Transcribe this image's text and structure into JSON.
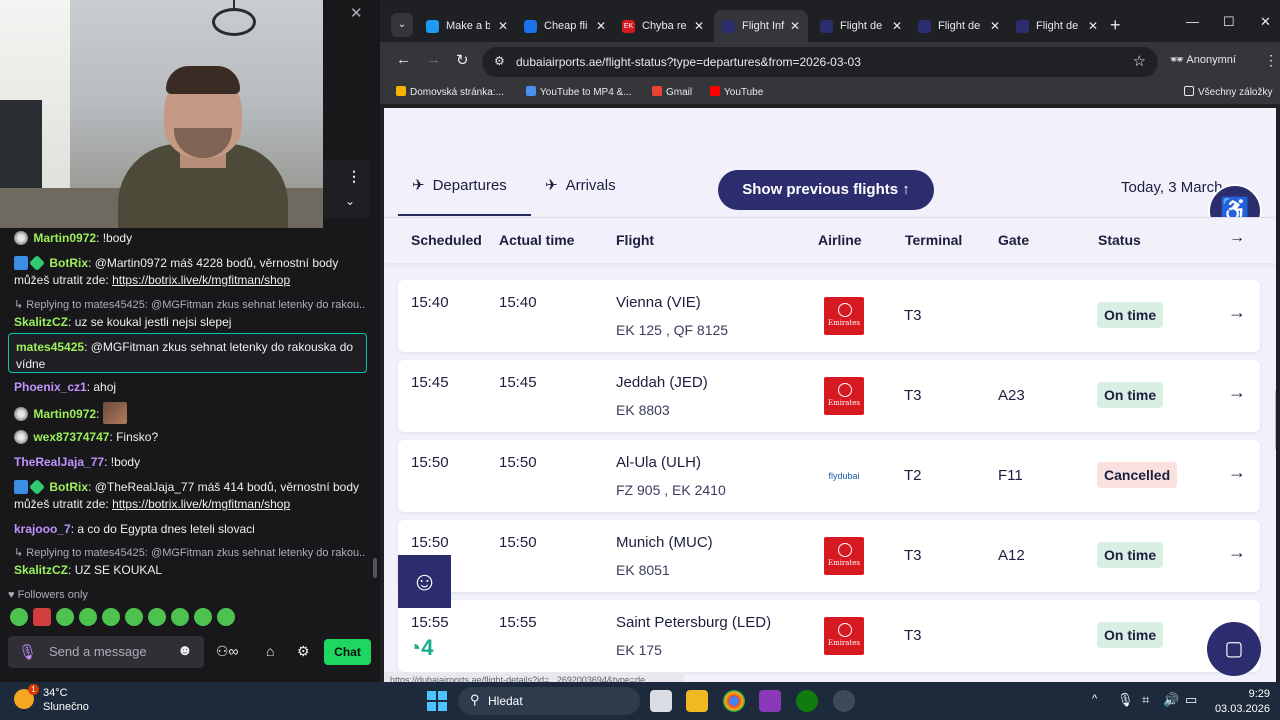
{
  "stream": {
    "close_glyph": "✕",
    "chat_messages": [
      {
        "user": "Martin0972",
        "user_color": "#9cf05a",
        "text": "!body",
        "badges": [
          "verified"
        ]
      },
      {
        "user": "BotRix",
        "user_color": "#9cf05a",
        "text": "@Martin0972 máš 4228 bodů, věrnostní body",
        "text2": "můžeš utratit zde:",
        "link": "https://botrix.live/k/mgfitman/shop",
        "badges": [
          "bot",
          "sub"
        ]
      },
      {
        "reply_to": "Replying to mates45425: @MGFitman zkus sehnat letenky do rakou...",
        "user": "SkalitzCZ",
        "user_color": "#9cf05a",
        "text": "uz se koukal jestli nejsi slepej"
      },
      {
        "user": "mates45425",
        "user_color": "#9cf05a",
        "text": "@MGFitman zkus sehnat letenky do rakouska do",
        "text2": "vídne",
        "highlighted": true
      },
      {
        "user": "Phoenix_cz1",
        "user_color": "#bf94ff",
        "text": "ahoj"
      },
      {
        "user": "Martin0972",
        "user_color": "#9cf05a",
        "text": "",
        "badges": [
          "verified"
        ],
        "emote": true
      },
      {
        "user": "wex87374747",
        "user_color": "#9cf05a",
        "text": "Finsko?",
        "badges": [
          "verified"
        ]
      },
      {
        "user": "TheRealJaja_77",
        "user_color": "#bf94ff",
        "text": "!body"
      },
      {
        "user": "BotRix",
        "user_color": "#9cf05a",
        "text": "@TheRealJaja_77 máš 414 bodů, věrnostní body",
        "text2": "můžeš utratit zde:",
        "link": "https://botrix.live/k/mgfitman/shop",
        "badges": [
          "bot",
          "sub"
        ]
      },
      {
        "user": "krajooo_7",
        "user_color": "#bf94ff",
        "text": "a co do Egypta dnes leteli slovaci"
      },
      {
        "reply_to": "Replying to mates45425: @MGFitman zkus sehnat letenky do rakou...",
        "user": "SkalitzCZ",
        "user_color": "#9cf05a",
        "text": "UZ SE KOUKAL"
      }
    ],
    "followers_only": "Followers only",
    "input_placeholder": "Send a message",
    "chat_button": "Chat"
  },
  "browser": {
    "tabs": [
      {
        "label": "Make a b",
        "favicon_color": "#1d9bf0",
        "active": false
      },
      {
        "label": "Cheap fli",
        "favicon_color": "#1a73e8",
        "active": false
      },
      {
        "label": "Chyba re",
        "favicon_color": "#d71a21",
        "favicon_text": "EK",
        "active": false
      },
      {
        "label": "Flight Inf",
        "favicon_color": "#2c2d6e",
        "active": true
      },
      {
        "label": "Flight de",
        "favicon_color": "#2c2d6e",
        "active": false
      },
      {
        "label": "Flight de",
        "favicon_color": "#2c2d6e",
        "active": false
      },
      {
        "label": "Flight de",
        "favicon_color": "#2c2d6e",
        "active": false
      }
    ],
    "url": "dubaiairports.ae/flight-status?type=departures&from=2026-03-03",
    "profile_label": "Anonymní",
    "bookmarks": [
      {
        "label": "Domovská stránka:...",
        "color": "#f4b400"
      },
      {
        "label": "YouTube to MP4 &...",
        "color": "#4a8ef0"
      },
      {
        "label": "Gmail",
        "color": "#ea4335"
      },
      {
        "label": "YouTube",
        "color": "#ff0000"
      }
    ],
    "all_bookmarks": "Všechny záložky",
    "status_url": "https://dubaiairports.ae/flight-details?id=...2692003694&type=de..."
  },
  "page": {
    "tab_departures": "Departures",
    "tab_arrivals": "Arrivals",
    "show_previous": "Show previous flights",
    "date": "Today, 3 March",
    "columns": [
      "Scheduled",
      "Actual time",
      "Flight",
      "Airline",
      "Terminal",
      "Gate",
      "Status"
    ],
    "flights": [
      {
        "scheduled": "15:40",
        "actual": "15:40",
        "destination": "Vienna (VIE)",
        "flight_numbers": "EK 125 , QF 8125",
        "airline": "Emirates",
        "terminal": "T3",
        "gate": "",
        "status": "On time",
        "status_kind": "ok"
      },
      {
        "scheduled": "15:45",
        "actual": "15:45",
        "destination": "Jeddah (JED)",
        "flight_numbers": "EK 8803",
        "airline": "Emirates",
        "terminal": "T3",
        "gate": "A23",
        "status": "On time",
        "status_kind": "ok"
      },
      {
        "scheduled": "15:50",
        "actual": "15:50",
        "destination": "Al-Ula (ULH)",
        "flight_numbers": "FZ 905 , EK 2410",
        "airline": "flydubai",
        "terminal": "T2",
        "gate": "F11",
        "status": "Cancelled",
        "status_kind": "cx"
      },
      {
        "scheduled": "15:50",
        "actual": "15:50",
        "destination": "Munich (MUC)",
        "flight_numbers": "EK 8051",
        "airline": "Emirates",
        "terminal": "T3",
        "gate": "A12",
        "status": "On time",
        "status_kind": "ok"
      },
      {
        "scheduled": "15:55",
        "actual": "15:55",
        "destination": "Saint Petersburg (LED)",
        "flight_numbers": "EK 175",
        "airline": "Emirates",
        "terminal": "T3",
        "gate": "",
        "status": "On time",
        "status_kind": "ok"
      }
    ]
  },
  "taskbar": {
    "temperature": "34°C",
    "weather": "Slunečno",
    "notification_count": "1",
    "search_label": "Hledat",
    "time": "9:29",
    "date": "03.03.2026"
  }
}
